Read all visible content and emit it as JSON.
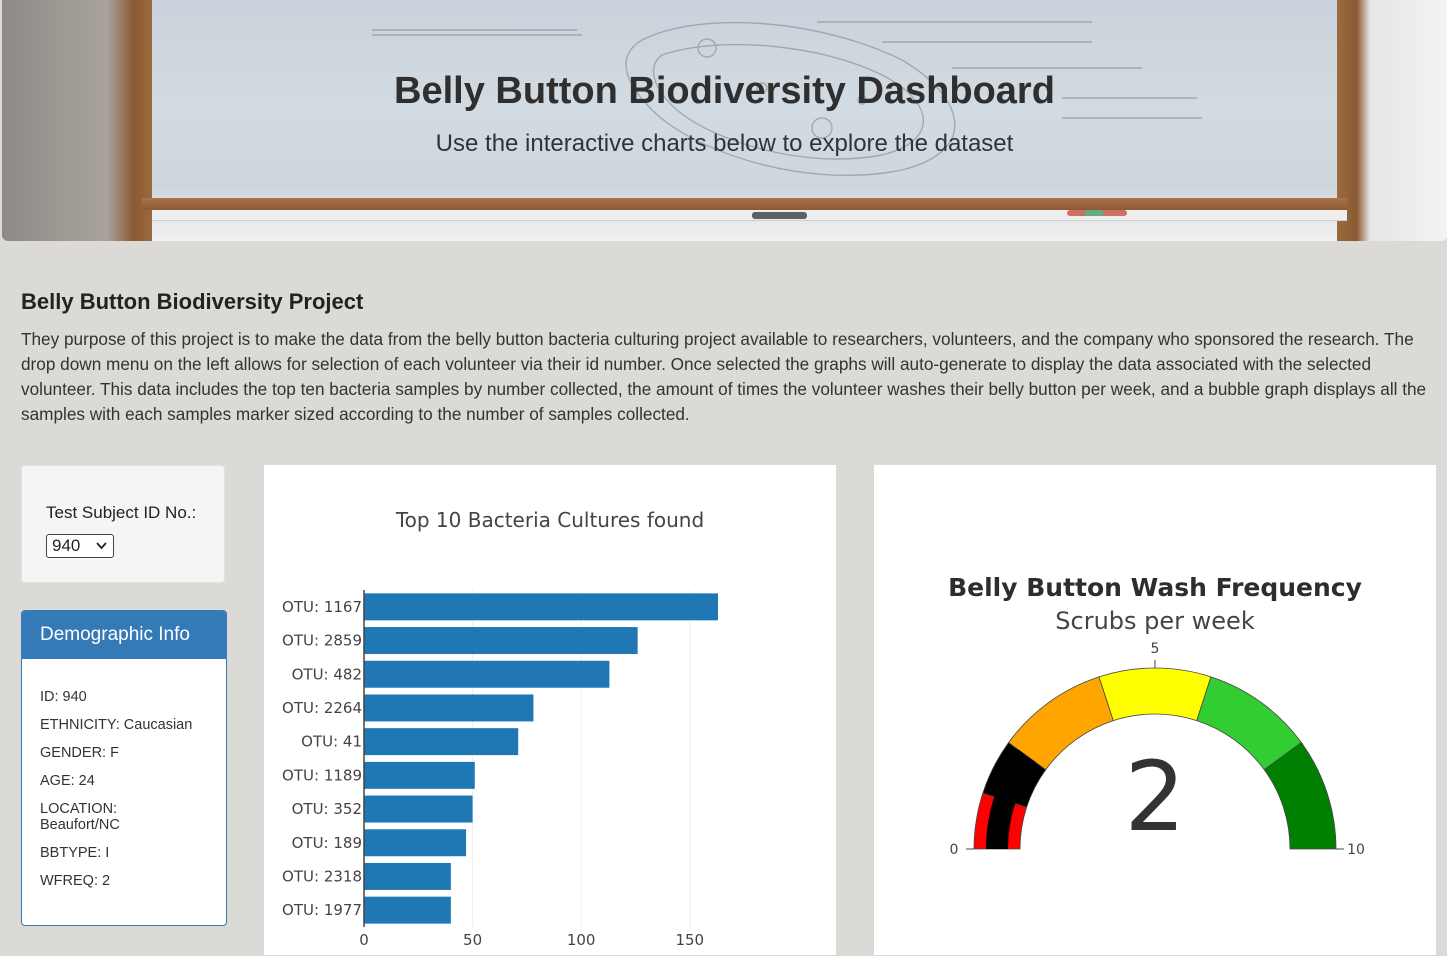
{
  "header": {
    "title": "Belly Button Biodiversity Dashboard",
    "subtitle": "Use the interactive charts below to explore the dataset"
  },
  "project": {
    "title": "Belly Button Biodiversity Project",
    "description": "They purpose of this project is to make the data from the belly button bacteria culturing project available to researchers, volunteers, and the company who sponsored the research. The drop down menu on the left allows for selection of each volunteer via their id number. Once selected the graphs will auto-generate to display the data associated with the selected volunteer. This data includes the top ten bacteria samples by number collected, the amount of times the volunteer washes their belly button per week, and a bubble graph displays all the samples with each samples marker sized according to the number of samples collected."
  },
  "selector": {
    "label": "Test Subject ID No.:",
    "selected": "940"
  },
  "demographics": {
    "heading": "Demographic Info",
    "rows": [
      "ID: 940",
      "ETHNICITY: Caucasian",
      "GENDER: F",
      "AGE: 24",
      "LOCATION: Beaufort/NC",
      "BBTYPE: I",
      "WFREQ: 2"
    ]
  },
  "colors": {
    "bar": "#1f77b4",
    "panel_header": "#337ab7"
  },
  "chart_data": [
    {
      "type": "bar",
      "orientation": "horizontal",
      "title": "Top 10 Bacteria Cultures found",
      "categories": [
        "OTU: 1167",
        "OTU: 2859",
        "OTU: 482",
        "OTU: 2264",
        "OTU: 41",
        "OTU: 1189",
        "OTU: 352",
        "OTU: 189",
        "OTU: 2318",
        "OTU: 1977"
      ],
      "values": [
        163,
        126,
        113,
        78,
        71,
        51,
        50,
        47,
        40,
        40
      ],
      "xlim": [
        0,
        163
      ],
      "xticks": [
        0,
        50,
        100,
        150
      ],
      "grid": true,
      "color": "#1f77b4"
    },
    {
      "type": "gauge",
      "title": "Belly Button Wash Frequency",
      "subtitle": "Scrubs per week",
      "value": 2,
      "range": [
        0,
        10
      ],
      "tick_labels": [
        "0",
        "5",
        "10"
      ],
      "bands": [
        {
          "from": 0,
          "to": 1,
          "color": "#ff0000"
        },
        {
          "from": 1,
          "to": 2,
          "color": "#000000"
        },
        {
          "from": 2,
          "to": 4,
          "color": "#ffa500"
        },
        {
          "from": 4,
          "to": 6,
          "color": "#ffff00"
        },
        {
          "from": 6,
          "to": 8,
          "color": "#32cd32"
        },
        {
          "from": 8,
          "to": 10,
          "color": "#008000"
        }
      ]
    }
  ]
}
